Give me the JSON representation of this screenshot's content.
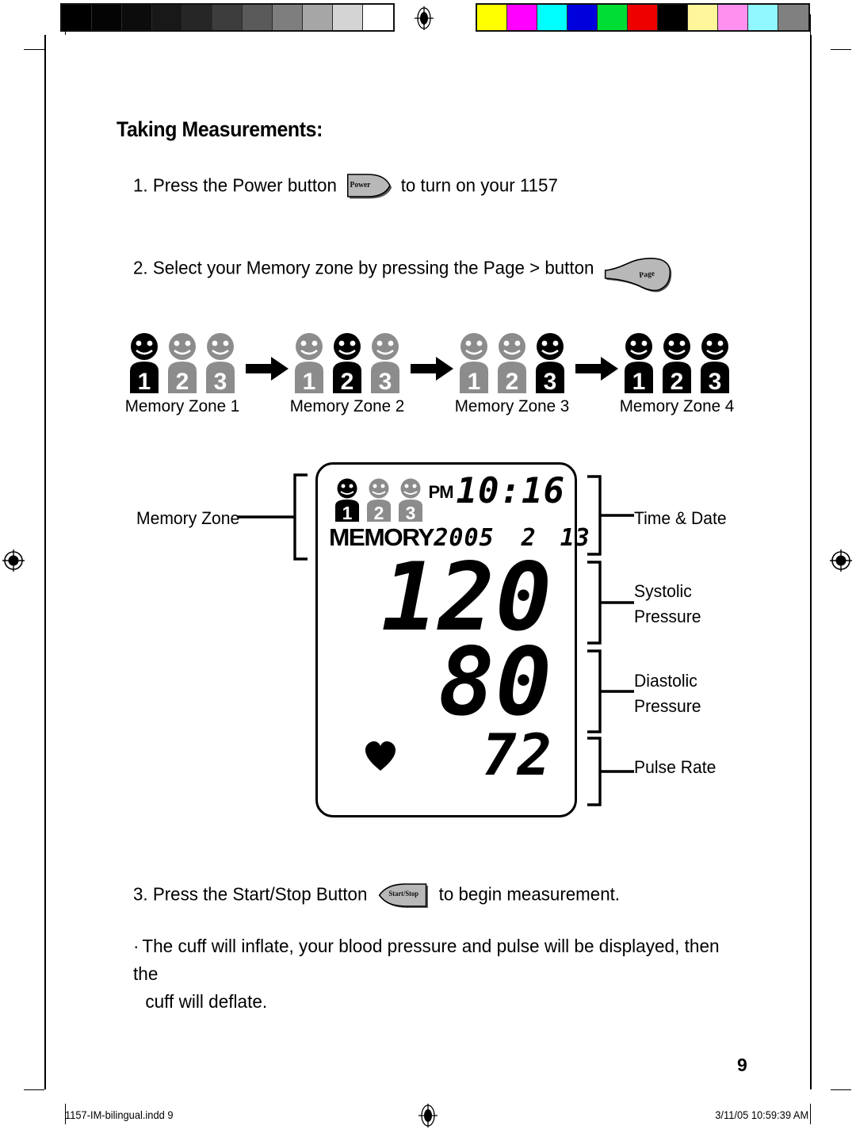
{
  "document": {
    "page_title": "Taking Measurements:",
    "page_number": "9"
  },
  "calibration": {
    "grayscale_swatches": [
      "#000000",
      "#040404",
      "#0c0c0c",
      "#181818",
      "#262626",
      "#3d3d3d",
      "#5a5a5a",
      "#7e7e7e",
      "#a6a6a6",
      "#d4d4d4",
      "#ffffff"
    ],
    "color_swatches": [
      "#ffff00",
      "#ff00ff",
      "#00ffff",
      "#0000dd",
      "#00dd33",
      "#ee0000",
      "#000000",
      "#fff79a",
      "#ff90f0",
      "#90f8ff",
      "#808080"
    ]
  },
  "steps": {
    "step1": {
      "number": "1.",
      "text_before": "Press the Power button",
      "button_label": "Power",
      "text_after": "to turn on your 1157"
    },
    "step2": {
      "number": "2.",
      "text_before": "Select your Memory zone by pressing the Page > button",
      "button_label": "Page",
      "button_arrow": "▶"
    },
    "step3": {
      "number": "3.",
      "text_before": "Press the Start/Stop Button",
      "button_label": "Start/Stop",
      "text_after": "to begin measurement."
    }
  },
  "bullet_note": {
    "mark": "·",
    "line1": "The cuff will inflate, your blood pressure and pulse will be displayed, then the",
    "line2": "cuff will deflate."
  },
  "memory_zones": [
    {
      "caption": "Memory Zone 1",
      "active_index": 0,
      "digits": [
        "1",
        "2",
        "3"
      ]
    },
    {
      "caption": "Memory Zone 2",
      "active_index": 1,
      "digits": [
        "1",
        "2",
        "3"
      ]
    },
    {
      "caption": "Memory Zone 3",
      "active_index": 2,
      "digits": [
        "1",
        "2",
        "3"
      ]
    },
    {
      "caption": "Memory Zone 4",
      "active_index": 3,
      "digits": [
        "1",
        "2",
        "3"
      ]
    }
  ],
  "lcd": {
    "people_digits": [
      "1",
      "2",
      "3"
    ],
    "active_person_index": 0,
    "meridiem": "PM",
    "clock": "10:16",
    "memory_word": "MEMORY",
    "year": "2005",
    "month": "2",
    "day": "13",
    "systolic": "120",
    "diastolic": "80",
    "pulse": "72",
    "heart_icon": "heart-icon"
  },
  "callouts": {
    "memory_zone": "Memory Zone",
    "time_date": "Time & Date",
    "systolic_line1": "Systolic",
    "systolic_line2": "Pressure",
    "diastolic_line1": "Diastolic",
    "diastolic_line2": "Pressure",
    "pulse_rate": "Pulse Rate"
  },
  "footer": {
    "left": "1157-IM-bilingual.indd   9",
    "right": "3/11/05   10:59:39 AM"
  },
  "colors": {
    "ink": "#000000",
    "paper": "#ffffff",
    "person_active": "#000000",
    "person_inactive": "#8c8c8c",
    "button_face": "#b8b8b8",
    "button_shadow": "#555555"
  }
}
